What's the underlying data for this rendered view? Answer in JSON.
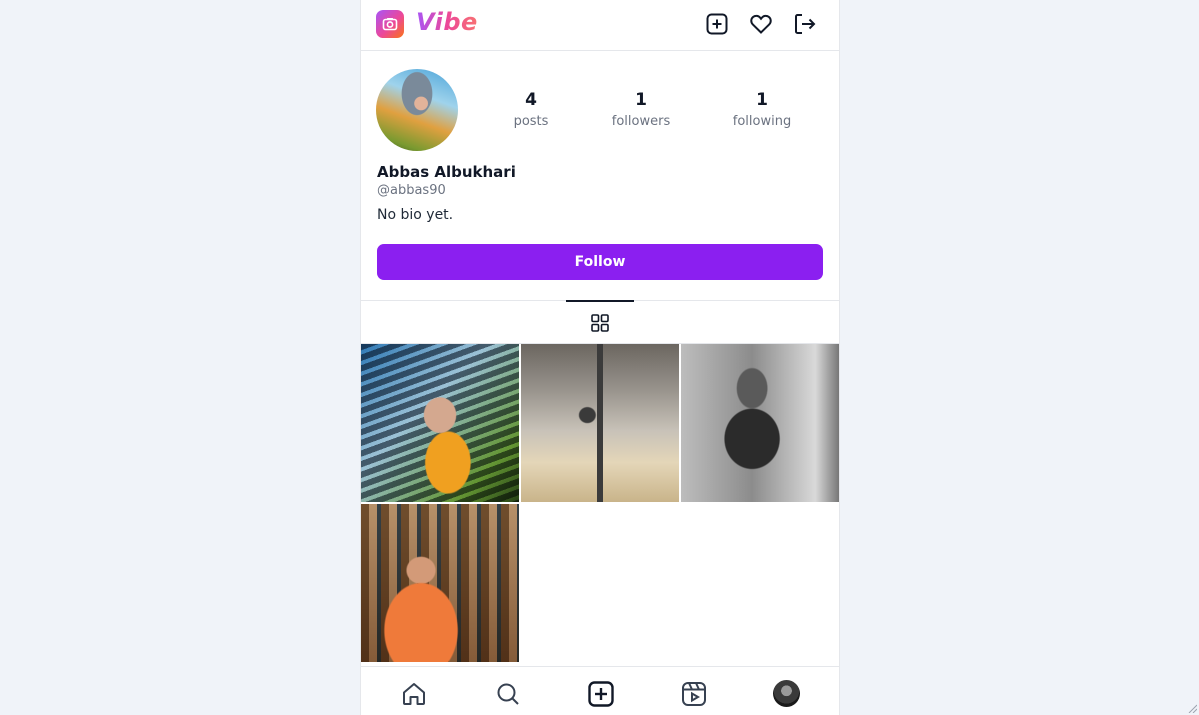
{
  "header": {
    "brand": "Vibe",
    "icons": [
      "camera-icon",
      "plus-square-icon",
      "heart-icon",
      "logout-icon"
    ]
  },
  "profile": {
    "stats": [
      {
        "value": "4",
        "label": "posts"
      },
      {
        "value": "1",
        "label": "followers"
      },
      {
        "value": "1",
        "label": "following"
      }
    ],
    "name": "Abbas Albukhari",
    "handle": "@abbas90",
    "bio": "No bio yet.",
    "follow_label": "Follow"
  },
  "tabs": {
    "active": "grid-icon"
  },
  "posts": [
    {
      "desc": "selfie-hoodie"
    },
    {
      "desc": "gym-mirror"
    },
    {
      "desc": "gym-mirror-bw"
    },
    {
      "desc": "gym-selfie-orange"
    }
  ],
  "bottom_nav": [
    "home-icon",
    "search-icon",
    "create-icon",
    "reels-icon",
    "profile-avatar"
  ],
  "colors": {
    "accent": "#8b1ff0",
    "brand_gradient": [
      "#a855f7",
      "#ec4899",
      "#f97316"
    ],
    "text_muted": "#6b7280",
    "page_bg": "#f0f3f9"
  }
}
